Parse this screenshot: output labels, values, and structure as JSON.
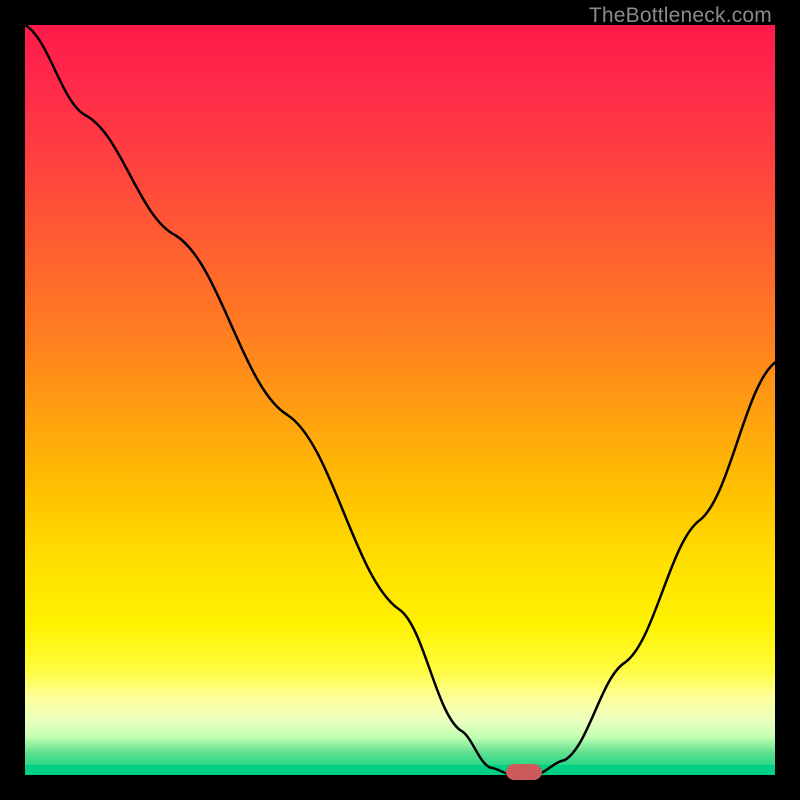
{
  "watermark": "TheBottleneck.com",
  "chart_data": {
    "type": "line",
    "title": "",
    "xlabel": "",
    "ylabel": "",
    "xlim": [
      0,
      100
    ],
    "ylim": [
      0,
      100
    ],
    "x": [
      0,
      8,
      20,
      35,
      50,
      58,
      62,
      65,
      68,
      72,
      80,
      90,
      100
    ],
    "values": [
      100,
      88,
      72,
      48,
      22,
      6,
      1,
      0,
      0,
      2,
      15,
      34,
      55
    ],
    "marker": {
      "x": 66.5,
      "y": 0
    },
    "gradient_stops": [
      {
        "pos": 0,
        "color": "#ff1a4a"
      },
      {
        "pos": 50,
        "color": "#ffa010"
      },
      {
        "pos": 80,
        "color": "#fff200"
      },
      {
        "pos": 100,
        "color": "#00d084"
      }
    ]
  }
}
